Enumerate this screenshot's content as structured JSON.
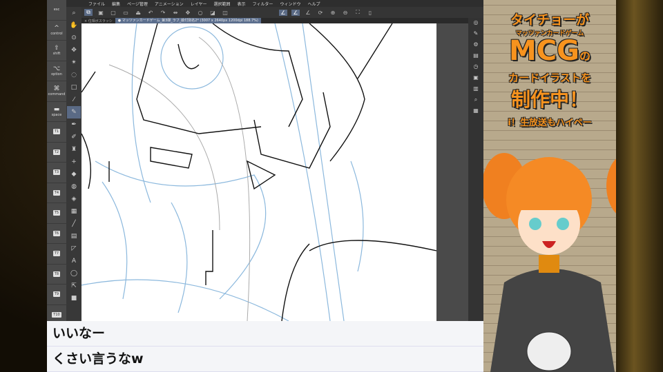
{
  "app": {
    "menu": [
      "ファイル",
      "編集",
      "ページ管理",
      "アニメーション",
      "レイヤー",
      "選択範囲",
      "表示",
      "フィルター",
      "ウィンドウ",
      "ヘルプ"
    ],
    "tabs": [
      {
        "label": "× 位相ボスラッシ"
      },
      {
        "label": "● マッツァンカードゲーム_第3弾_ラフ_絵付別名2* (3007 x 2640px 1200dpi 188.7%)"
      }
    ],
    "keys": [
      {
        "icon": "esc",
        "label": "esc"
      },
      {
        "icon": "^",
        "label": "control"
      },
      {
        "icon": "⇧",
        "label": "shift"
      },
      {
        "icon": "⌥",
        "label": "option"
      },
      {
        "icon": "⌘",
        "label": "command"
      },
      {
        "icon": "▬",
        "label": "space"
      },
      {
        "label": "T1"
      },
      {
        "label": "T2"
      },
      {
        "label": "T3"
      },
      {
        "label": "T4"
      },
      {
        "label": "T5"
      },
      {
        "label": "T6"
      },
      {
        "label": "T7"
      },
      {
        "label": "T8"
      },
      {
        "label": "T9"
      },
      {
        "label": "T10"
      }
    ]
  },
  "chat": {
    "messages": [
      "いいなー",
      "くさい言うなw"
    ]
  },
  "overlay": {
    "line1": "タイチョーが",
    "line2": "マッツァンカードゲーム",
    "line3": "MCG",
    "line3b": "の",
    "line4": "カードイラストを",
    "line5": "制作中！",
    "line6": "i！生放送もハイペー"
  },
  "colors": {
    "accent": "#f7931e",
    "active_tool": "#5a6a85"
  }
}
